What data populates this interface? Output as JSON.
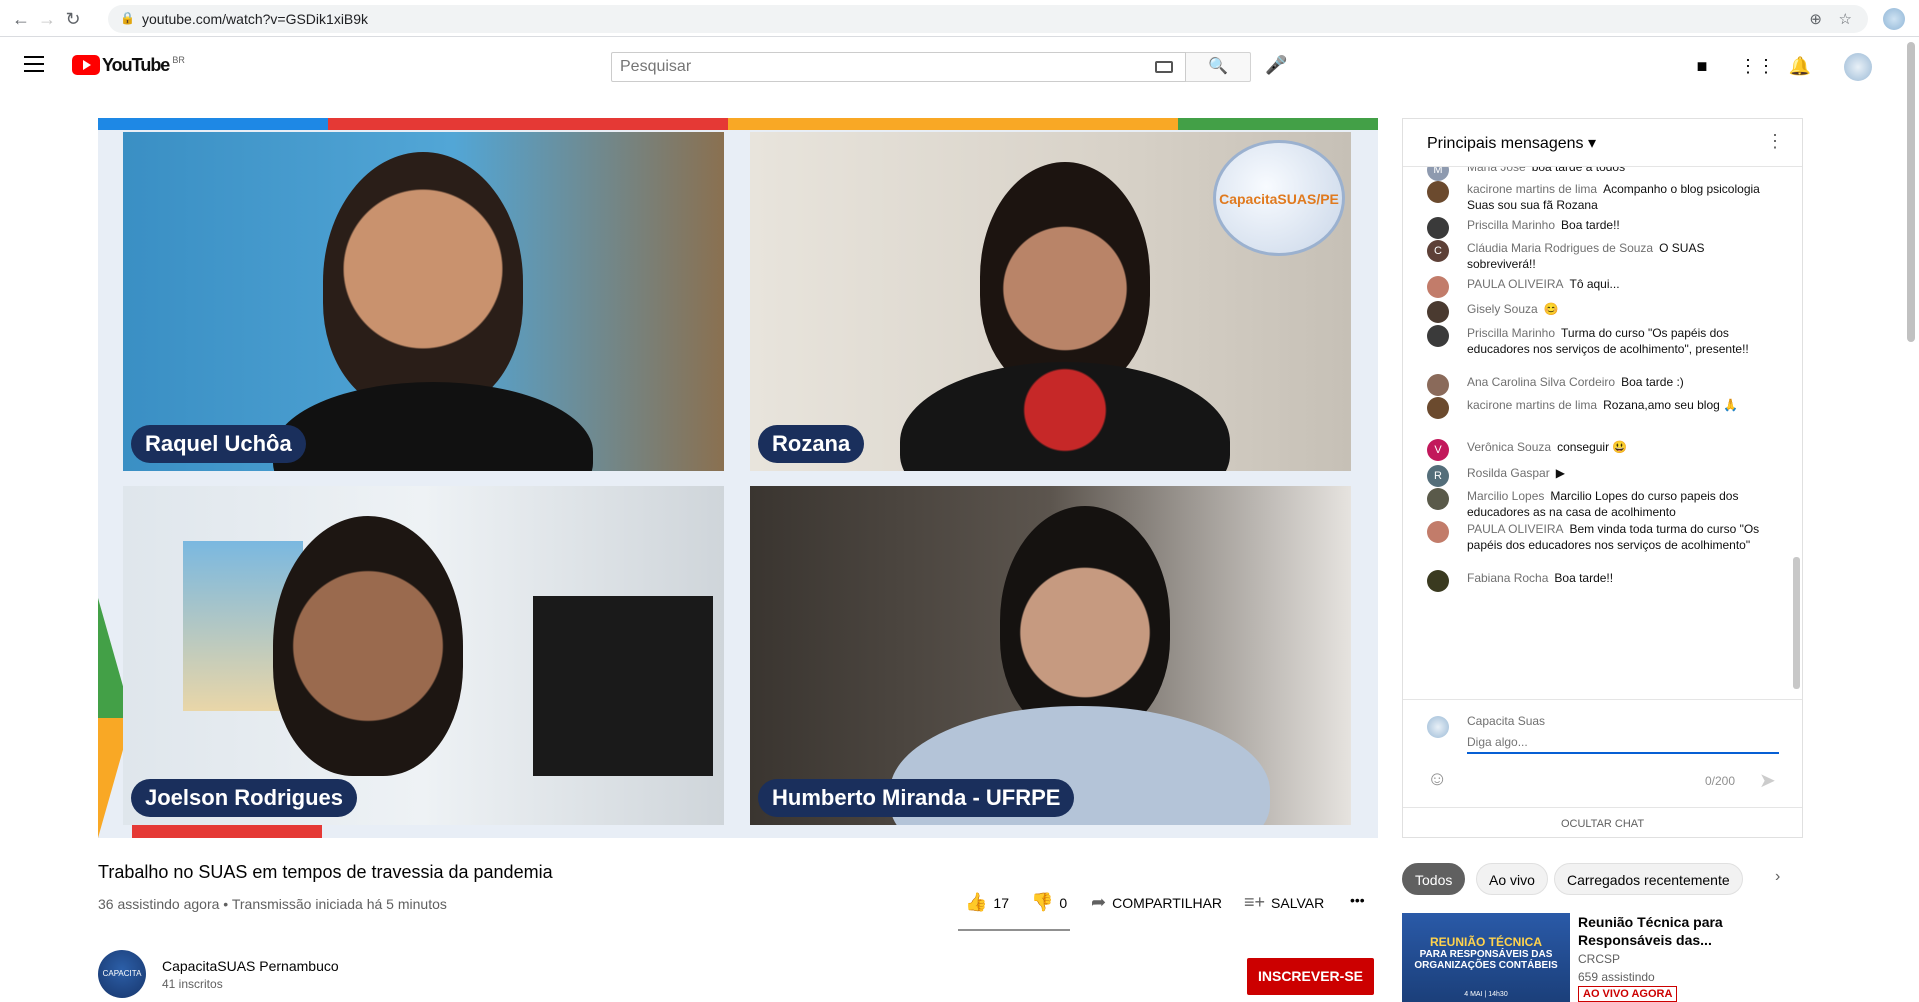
{
  "browser": {
    "url": "youtube.com/watch?v=GSDik1xiB9k"
  },
  "header": {
    "logo_text": "YouTube",
    "country_code": "BR",
    "search_placeholder": "Pesquisar"
  },
  "video": {
    "participants": [
      "Raquel Uchôa",
      "Rozana",
      "Joelson Rodrigues",
      "Humberto Miranda - UFRPE"
    ],
    "logo_text": "CapacitaSUAS/PE",
    "title": "Trabalho no SUAS em tempos de travessia da pandemia",
    "meta": "36 assistindo agora • Transmissão iniciada há 5 minutos",
    "likes": "17",
    "dislikes": "0",
    "share_label": "COMPARTILHAR",
    "save_label": "SALVAR",
    "more_label": "•••"
  },
  "channel": {
    "name": "CapacitaSUAS Pernambuco",
    "subscribers": "41 inscritos",
    "subscribe_label": "INSCREVER-SE",
    "avatar_text": "CAPACITA SUAS/PE"
  },
  "chat": {
    "header": "Principais mensagens",
    "messages": [
      {
        "author": "Maria Jose",
        "text": "boa tarde a todos",
        "initial": "M",
        "color": "#8e9aaf"
      },
      {
        "author": "kacirone martins de lima",
        "text": "Acompanho o blog psicologia Suas sou sua fã Rozana",
        "initial": "",
        "color": "#6b4a2e"
      },
      {
        "author": "Priscilla Marinho",
        "text": "Boa tarde!!",
        "initial": "",
        "color": "#3a3a3a"
      },
      {
        "author": "Cláudia Maria Rodrigues de Souza",
        "text": "O SUAS sobreviverá!!",
        "initial": "C",
        "color": "#5d4037"
      },
      {
        "author": "PAULA OLIVEIRA",
        "text": "Tô aqui...",
        "initial": "",
        "color": "#c27c6a"
      },
      {
        "author": "Gisely Souza",
        "text": "😊",
        "initial": "",
        "color": "#4a3a30"
      },
      {
        "author": "Priscilla Marinho",
        "text": "Turma do curso \"Os papéis dos educadores nos serviços de acolhimento\", presente!!",
        "initial": "",
        "color": "#3a3a3a"
      },
      {
        "author": "Ana Carolina Silva Cordeiro",
        "text": "Boa tarde :)",
        "initial": "",
        "color": "#8a6a5a"
      },
      {
        "author": "kacirone martins de lima",
        "text": "Rozana,amo seu blog 🙏",
        "initial": "",
        "color": "#6b4a2e"
      },
      {
        "author": "Verônica Souza",
        "text": "conseguir 😃",
        "initial": "V",
        "color": "#c2185b"
      },
      {
        "author": "Rosilda Gaspar",
        "text": "▶",
        "initial": "R",
        "color": "#546e7a"
      },
      {
        "author": "Marcilio Lopes",
        "text": "Marcilio Lopes do curso papeis dos educadores as na casa de acolhimento",
        "initial": "",
        "color": "#5a5a4a"
      },
      {
        "author": "PAULA OLIVEIRA",
        "text": "Bem vinda toda turma do curso \"Os papéis dos educadores nos serviços de acolhimento\"",
        "initial": "",
        "color": "#c27c6a"
      },
      {
        "author": "Fabiana Rocha",
        "text": "Boa tarde!!",
        "initial": "",
        "color": "#3a3a20"
      }
    ],
    "composer_name": "Capacita Suas",
    "composer_placeholder": "Diga algo...",
    "char_count": "0/200",
    "hide_label": "OCULTAR CHAT"
  },
  "chips": [
    "Todos",
    "Ao vivo",
    "Carregados recentemente"
  ],
  "suggestion": {
    "title": "Reunião Técnica para Responsáveis das...",
    "channel": "CRCSP",
    "views": "659 assistindo",
    "badge": "AO VIVO AGORA",
    "thumb_line1": "REUNIÃO TÉCNICA",
    "thumb_line2": "PARA RESPONSÁVEIS DAS ORGANIZAÇÕES CONTÁBEIS",
    "thumb_line3": "4 MAI | 14h30"
  }
}
